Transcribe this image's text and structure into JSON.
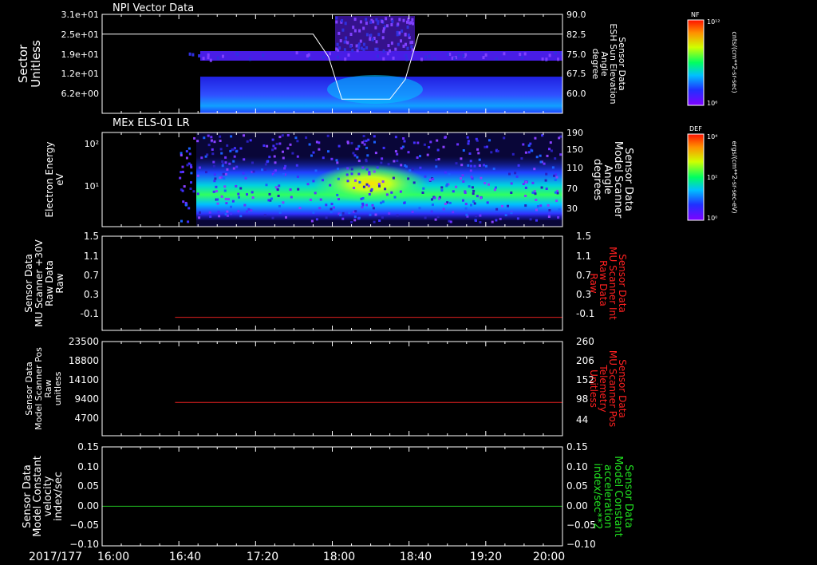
{
  "date_label": "2017/177",
  "time_ticks": [
    "16:00",
    "16:40",
    "17:20",
    "18:00",
    "18:40",
    "19:20",
    "20:00"
  ],
  "panels": [
    {
      "id": "npi",
      "title": "NPI Vector Data",
      "left_label": [
        "Sector",
        "Unitless"
      ],
      "left_ticks": [
        "3.1e+01",
        "2.5e+01",
        "1.9e+01",
        "1.2e+01",
        "6.2e+00"
      ],
      "right_label": [
        "Sensor Data",
        "ESH Sun Elevation",
        "Angle",
        "degree"
      ],
      "right_ticks": [
        "90.0",
        "82.5",
        "75.0",
        "67.5",
        "60.0"
      ],
      "colorbar": {
        "tag": "NF",
        "top": "10¹²",
        "bottom": "10⁶",
        "unit": "cnts/(cm**2-sr-sec)"
      }
    },
    {
      "id": "els",
      "title": "MEx ELS-01 LR",
      "left_label": [
        "Electron Energy",
        "eV"
      ],
      "left_ticks": [
        "10²",
        "10¹"
      ],
      "right_label": [
        "Sensor Data",
        "Model Scanner",
        "Angle",
        "degrees"
      ],
      "right_ticks": [
        "190",
        "150",
        "110",
        "70",
        "30"
      ],
      "colorbar": {
        "tag": "DEF",
        "top": "10⁴",
        "mid": "10²",
        "bottom": "10⁰",
        "unit": "ergs/(cm**2-sr-sec-eV)"
      }
    },
    {
      "id": "mu30",
      "left_label": [
        "Sensor Data",
        "MU Scanner +30V",
        "Raw Data",
        "Raw"
      ],
      "left_ticks": [
        "1.5",
        "1.1",
        "0.7",
        "0.3",
        "-0.1"
      ],
      "right_label": [
        "Sensor Data",
        "MU Scanner Int",
        "Raw Data",
        "Raw"
      ],
      "right_ticks": [
        "1.5",
        "1.1",
        "0.7",
        "0.3",
        "-0.1"
      ]
    },
    {
      "id": "pos",
      "left_label": [
        "Sensor Data",
        "Model Scanner Pos",
        "Raw",
        "unitless"
      ],
      "left_ticks": [
        "23500",
        "18800",
        "14100",
        "9400",
        "4700"
      ],
      "right_label": [
        "Sensor Data",
        "MU Scanner Pos",
        "Telemetry",
        "Unitless"
      ],
      "right_ticks": [
        "260",
        "206",
        "152",
        "98",
        "44"
      ]
    },
    {
      "id": "vel",
      "left_label": [
        "Sensor Data",
        "Model Constant",
        "velocity",
        "index/sec"
      ],
      "left_ticks": [
        "0.15",
        "0.10",
        "0.05",
        "0.00",
        "−0.05",
        "−0.10"
      ],
      "right_label": [
        "Sensor Data",
        "Model Constant",
        "acceleration",
        "index/sec**2"
      ],
      "right_ticks": [
        "0.15",
        "0.10",
        "0.05",
        "0.00",
        "−0.05",
        "−0.10"
      ]
    }
  ],
  "colors": {
    "background": "#000000",
    "axis": "#ffffff",
    "right_label_red": "#ff2020",
    "right_label_green": "#20e020",
    "trace_red": "#e02020",
    "trace_green": "#20c020"
  },
  "chart_data": [
    {
      "type": "heatmap",
      "title": "NPI Vector Data",
      "x_range": [
        "16:00",
        "20:00"
      ],
      "ylabel": "Sector Unitless",
      "y_ticks": [
        31,
        25,
        19,
        12,
        6.2
      ],
      "data_start": "16:45",
      "overlay_line": {
        "name": "ESH Sun Elevation Angle",
        "unit": "degree",
        "y_range": [
          55,
          90
        ],
        "x": [
          "16:00",
          "17:50",
          "17:58",
          "18:05",
          "18:30",
          "18:38",
          "18:45",
          "20:00"
        ],
        "y": [
          83,
          83,
          75,
          60,
          60,
          67,
          83,
          83
        ]
      }
    },
    {
      "type": "heatmap",
      "title": "MEx ELS-01 LR",
      "x_range": [
        "16:00",
        "20:00"
      ],
      "ylabel": "Electron Energy eV",
      "yscale": "log",
      "data_start": "16:40",
      "peak_interval": [
        "17:50",
        "18:50"
      ],
      "overlay_line": {
        "name": "Model Scanner Angle",
        "unit": "degrees",
        "y_range": [
          10,
          190
        ],
        "x": [
          "16:00",
          "20:00"
        ],
        "y": [
          10,
          10
        ]
      }
    },
    {
      "type": "line",
      "x_range": [
        "16:00",
        "20:00"
      ],
      "ylim": [
        -0.3,
        1.5
      ],
      "series": [
        {
          "x": [
            "16:38",
            "20:00"
          ],
          "y": [
            -0.05,
            -0.05
          ]
        }
      ]
    },
    {
      "type": "line",
      "x_range": [
        "16:00",
        "20:00"
      ],
      "ylim": [
        0,
        23500
      ],
      "series": [
        {
          "x": [
            "16:38",
            "20:00"
          ],
          "y": [
            8300,
            8300
          ]
        }
      ]
    },
    {
      "type": "line",
      "x_range": [
        "16:00",
        "20:00"
      ],
      "ylim": [
        -0.1,
        0.15
      ],
      "series": [
        {
          "x": [
            "16:00",
            "20:00"
          ],
          "y": [
            0.0,
            0.0
          ]
        }
      ]
    }
  ]
}
